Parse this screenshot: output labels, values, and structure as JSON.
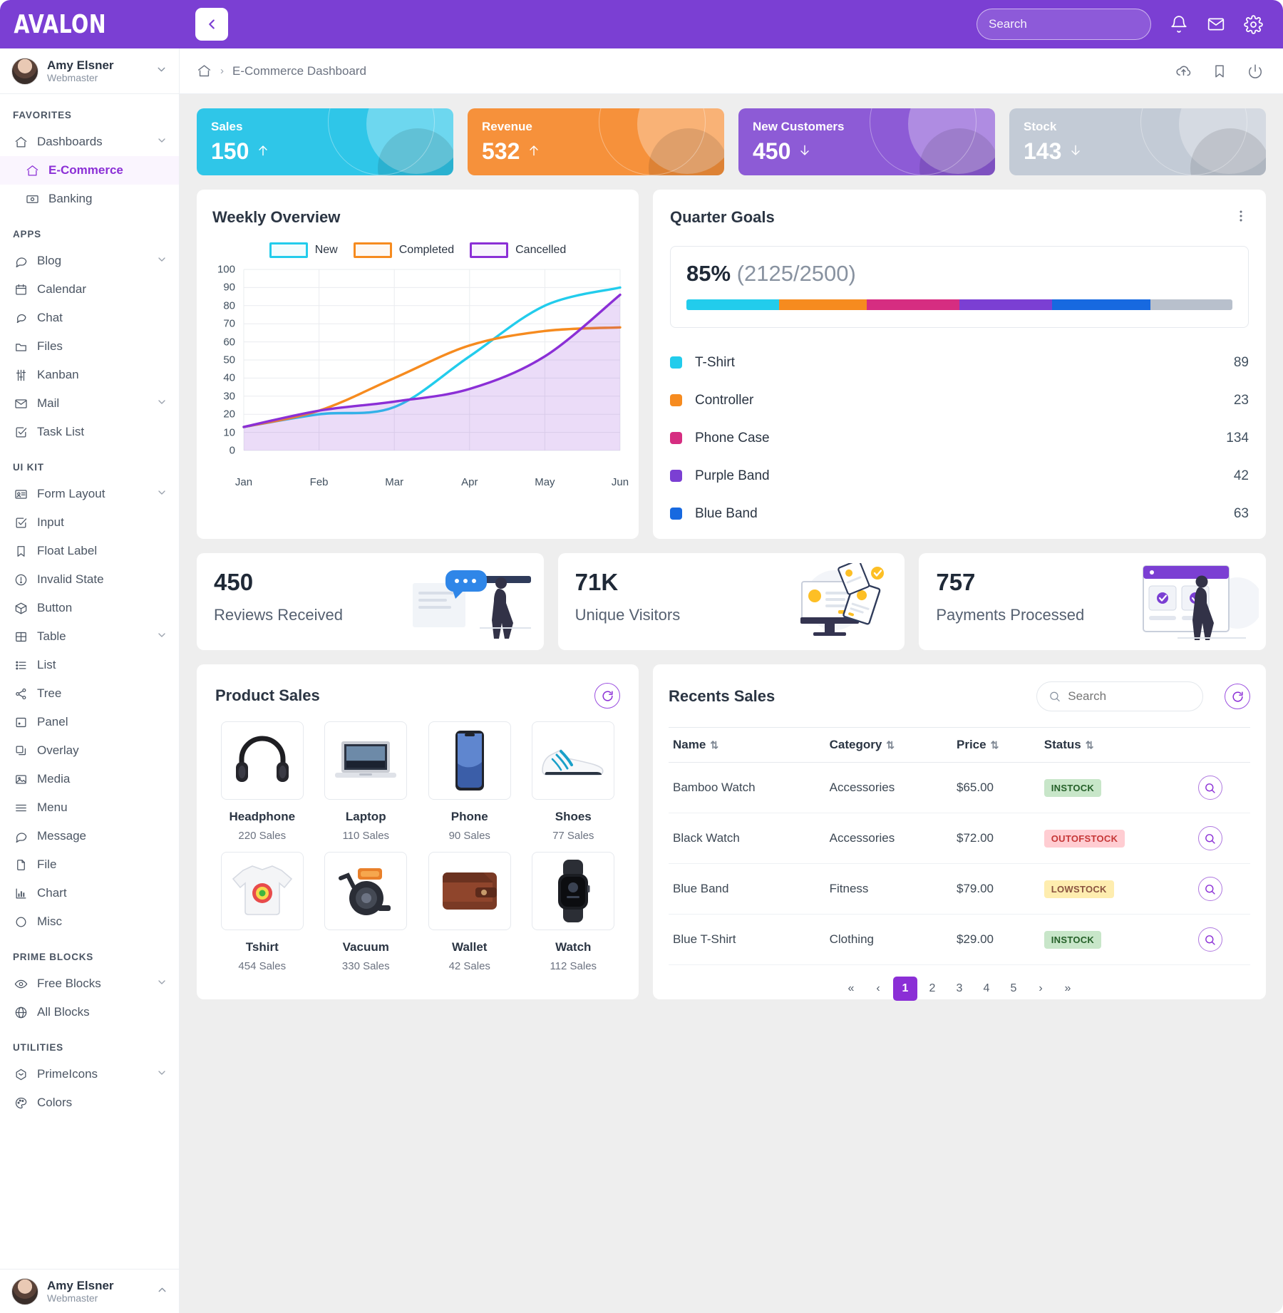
{
  "brand": "AVALON",
  "topbar": {
    "search_placeholder": "Search",
    "icons": [
      "bell-icon",
      "envelope-icon",
      "gear-icon"
    ]
  },
  "breadcrumb": {
    "home": "home-icon",
    "separator": "›",
    "current": "E-Commerce Dashboard",
    "actions": [
      "cloud-upload-icon",
      "bookmark-icon",
      "power-icon"
    ]
  },
  "profile": {
    "name": "Amy Elsner",
    "role": "Webmaster"
  },
  "sidebar": {
    "sections": [
      {
        "label": "FAVORITES",
        "items": [
          {
            "label": "Dashboards",
            "icon": "home-icon",
            "chevron": true,
            "active": false,
            "sub": false
          },
          {
            "label": "E-Commerce",
            "icon": "home-icon",
            "chevron": false,
            "active": true,
            "sub": true
          },
          {
            "label": "Banking",
            "icon": "money-icon",
            "chevron": false,
            "active": false,
            "sub": true
          }
        ]
      },
      {
        "label": "APPS",
        "items": [
          {
            "label": "Blog",
            "icon": "comment-icon",
            "chevron": true,
            "active": false,
            "sub": false
          },
          {
            "label": "Calendar",
            "icon": "calendar-icon",
            "chevron": false,
            "active": false,
            "sub": false
          },
          {
            "label": "Chat",
            "icon": "chat-icon",
            "chevron": false,
            "active": false,
            "sub": false
          },
          {
            "label": "Files",
            "icon": "folder-icon",
            "chevron": false,
            "active": false,
            "sub": false
          },
          {
            "label": "Kanban",
            "icon": "sliders-icon",
            "chevron": false,
            "active": false,
            "sub": false
          },
          {
            "label": "Mail",
            "icon": "envelope-icon",
            "chevron": true,
            "active": false,
            "sub": false
          },
          {
            "label": "Task List",
            "icon": "check-square-icon",
            "chevron": false,
            "active": false,
            "sub": false
          }
        ]
      },
      {
        "label": "UI KIT",
        "items": [
          {
            "label": "Form Layout",
            "icon": "id-card-icon",
            "chevron": true,
            "active": false,
            "sub": false
          },
          {
            "label": "Input",
            "icon": "check-square-icon",
            "chevron": false,
            "active": false,
            "sub": false
          },
          {
            "label": "Float Label",
            "icon": "bookmark-icon",
            "chevron": false,
            "active": false,
            "sub": false
          },
          {
            "label": "Invalid State",
            "icon": "exclamation-circle-icon",
            "chevron": false,
            "active": false,
            "sub": false
          },
          {
            "label": "Button",
            "icon": "box-icon",
            "chevron": false,
            "active": false,
            "sub": false
          },
          {
            "label": "Table",
            "icon": "table-icon",
            "chevron": true,
            "active": false,
            "sub": false
          },
          {
            "label": "List",
            "icon": "list-icon",
            "chevron": false,
            "active": false,
            "sub": false
          },
          {
            "label": "Tree",
            "icon": "share-icon",
            "chevron": false,
            "active": false,
            "sub": false
          },
          {
            "label": "Panel",
            "icon": "panel-icon",
            "chevron": false,
            "active": false,
            "sub": false
          },
          {
            "label": "Overlay",
            "icon": "clone-icon",
            "chevron": false,
            "active": false,
            "sub": false
          },
          {
            "label": "Media",
            "icon": "image-icon",
            "chevron": false,
            "active": false,
            "sub": false
          },
          {
            "label": "Menu",
            "icon": "bars-icon",
            "chevron": false,
            "active": false,
            "sub": false
          },
          {
            "label": "Message",
            "icon": "comment-icon",
            "chevron": false,
            "active": false,
            "sub": false
          },
          {
            "label": "File",
            "icon": "file-icon",
            "chevron": false,
            "active": false,
            "sub": false
          },
          {
            "label": "Chart",
            "icon": "chart-bar-icon",
            "chevron": false,
            "active": false,
            "sub": false
          },
          {
            "label": "Misc",
            "icon": "circle-icon",
            "chevron": false,
            "active": false,
            "sub": false
          }
        ]
      },
      {
        "label": "PRIME BLOCKS",
        "items": [
          {
            "label": "Free Blocks",
            "icon": "eye-icon",
            "chevron": true,
            "active": false,
            "sub": false
          },
          {
            "label": "All Blocks",
            "icon": "globe-icon",
            "chevron": false,
            "active": false,
            "sub": false
          }
        ]
      },
      {
        "label": "UTILITIES",
        "items": [
          {
            "label": "PrimeIcons",
            "icon": "prime-icon",
            "chevron": true,
            "active": false,
            "sub": false
          },
          {
            "label": "Colors",
            "icon": "palette-icon",
            "chevron": false,
            "active": false,
            "sub": false
          }
        ]
      }
    ]
  },
  "kpis": [
    {
      "label": "Sales",
      "value": "150",
      "trend": "up",
      "color": "#2FC6E8"
    },
    {
      "label": "Revenue",
      "value": "532",
      "trend": "up",
      "color": "#F6913B"
    },
    {
      "label": "New Customers",
      "value": "450",
      "trend": "down",
      "color": "#8D5BD6"
    },
    {
      "label": "Stock",
      "value": "143",
      "trend": "down",
      "color": "#C3CBD6"
    }
  ],
  "weekly": {
    "title": "Weekly Overview"
  },
  "chart_data": {
    "type": "line",
    "title": "Weekly Overview",
    "x": [
      "Jan",
      "Feb",
      "Mar",
      "Apr",
      "May",
      "Jun"
    ],
    "xlabel": "",
    "ylabel": "",
    "ylim": [
      0,
      100
    ],
    "yticks": [
      0,
      10,
      20,
      30,
      40,
      50,
      60,
      70,
      80,
      90,
      100
    ],
    "grid": true,
    "legend_position": "top-center",
    "series": [
      {
        "name": "New",
        "color": "#22CCEC",
        "fill": false,
        "values": [
          13,
          20,
          24,
          52,
          80,
          90
        ]
      },
      {
        "name": "Completed",
        "color": "#F68B1F",
        "fill": false,
        "values": [
          13,
          22,
          40,
          58,
          66,
          68
        ]
      },
      {
        "name": "Cancelled",
        "color": "#8B2FD6",
        "fill": true,
        "values": [
          13,
          22,
          27,
          34,
          52,
          86
        ]
      }
    ]
  },
  "quarter_goals": {
    "title": "Quarter Goals",
    "menu_icon": "ellipsis-v-icon",
    "percent_label": "85%",
    "fraction_label": "(2125/2500)",
    "bar_segments": [
      {
        "color": "#22CCEC",
        "pct": 17
      },
      {
        "color": "#F68B1F",
        "pct": 16
      },
      {
        "color": "#D62D81",
        "pct": 17
      },
      {
        "color": "#7B3FD3",
        "pct": 17
      },
      {
        "color": "#1769E0",
        "pct": 18
      },
      {
        "color": "#B8C0CC",
        "pct": 15
      }
    ],
    "items": [
      {
        "label": "T-Shirt",
        "value": "89",
        "color": "#22CCEC"
      },
      {
        "label": "Controller",
        "value": "23",
        "color": "#F68B1F"
      },
      {
        "label": "Phone Case",
        "value": "134",
        "color": "#D62D81"
      },
      {
        "label": "Purple Band",
        "value": "42",
        "color": "#7B3FD3"
      },
      {
        "label": "Blue Band",
        "value": "63",
        "color": "#1769E0"
      }
    ]
  },
  "stats": [
    {
      "value": "450",
      "caption": "Reviews Received",
      "art": "reviews-illustration"
    },
    {
      "value": "71K",
      "caption": "Unique Visitors",
      "art": "visitors-illustration"
    },
    {
      "value": "757",
      "caption": "Payments Processed",
      "art": "payments-illustration"
    }
  ],
  "product_sales": {
    "title": "Product Sales",
    "refresh_icon": "refresh-icon",
    "items": [
      {
        "name": "Headphone",
        "sales": "220 Sales",
        "art": "headphone-image"
      },
      {
        "name": "Laptop",
        "sales": "110 Sales",
        "art": "laptop-image"
      },
      {
        "name": "Phone",
        "sales": "90 Sales",
        "art": "phone-image"
      },
      {
        "name": "Shoes",
        "sales": "77 Sales",
        "art": "shoes-image"
      },
      {
        "name": "Tshirt",
        "sales": "454 Sales",
        "art": "tshirt-image"
      },
      {
        "name": "Vacuum",
        "sales": "330 Sales",
        "art": "vacuum-image"
      },
      {
        "name": "Wallet",
        "sales": "42 Sales",
        "art": "wallet-image"
      },
      {
        "name": "Watch",
        "sales": "112 Sales",
        "art": "watch-image"
      }
    ]
  },
  "recents_sales": {
    "title": "Recents Sales",
    "search_placeholder": "Search",
    "refresh_icon": "refresh-icon",
    "columns": [
      "Name",
      "Category",
      "Price",
      "Status"
    ],
    "rows": [
      {
        "name": "Bamboo Watch",
        "category": "Accessories",
        "price": "$65.00",
        "status": "INSTOCK",
        "status_kind": "in"
      },
      {
        "name": "Black Watch",
        "category": "Accessories",
        "price": "$72.00",
        "status": "OUTOFSTOCK",
        "status_kind": "out"
      },
      {
        "name": "Blue Band",
        "category": "Fitness",
        "price": "$79.00",
        "status": "LOWSTOCK",
        "status_kind": "low"
      },
      {
        "name": "Blue T-Shirt",
        "category": "Clothing",
        "price": "$29.00",
        "status": "INSTOCK",
        "status_kind": "in"
      }
    ],
    "pagination": [
      "«",
      "‹",
      "1",
      "2",
      "3",
      "4",
      "5",
      "›",
      "»"
    ],
    "current_page": "1"
  }
}
